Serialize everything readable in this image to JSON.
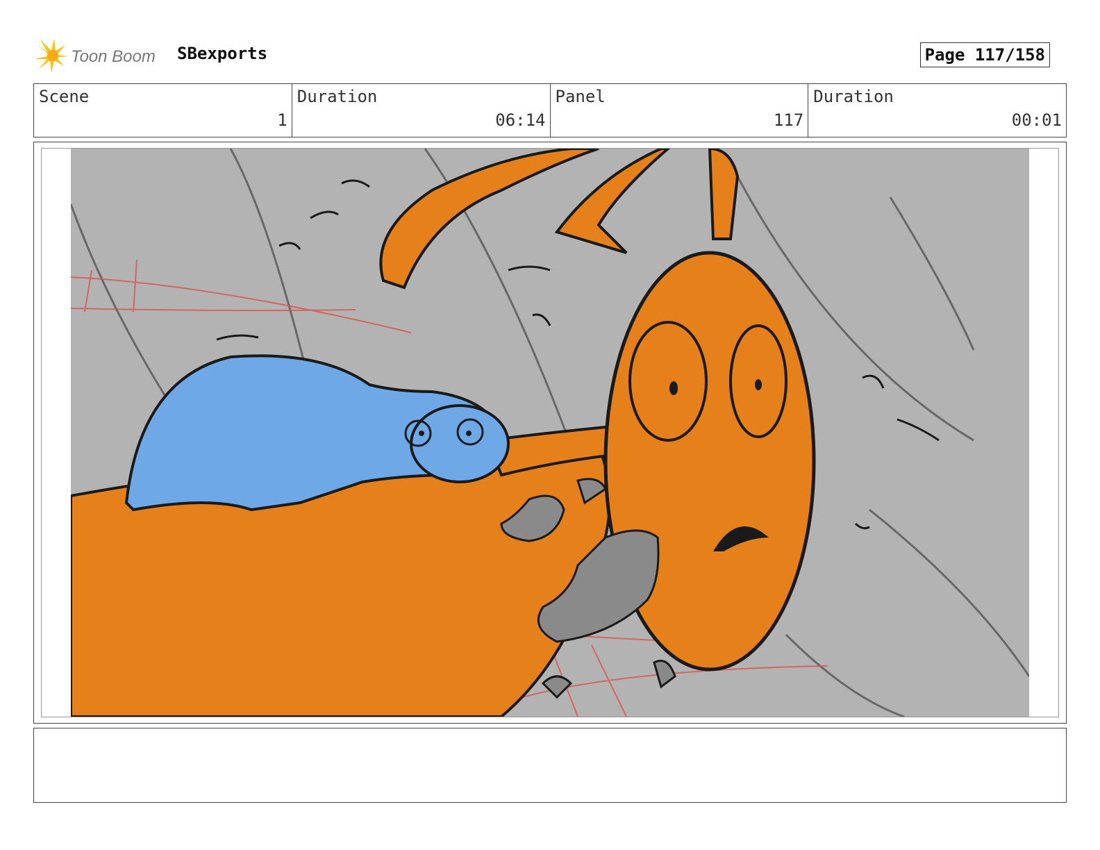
{
  "header": {
    "logo_text": "Toon Boom",
    "project": "SBexports",
    "page": "Page 117/158"
  },
  "info": {
    "scene_label": "Scene",
    "scene_value": "1",
    "scene_duration_label": "Duration",
    "scene_duration_value": "06:14",
    "panel_label": "Panel",
    "panel_value": "117",
    "panel_duration_label": "Duration",
    "panel_duration_value": "00:01"
  },
  "colors": {
    "orange": "#e5801a",
    "blue": "#6fa8e6",
    "background_gray": "#b3b3b3",
    "rubble_gray": "#8a8a8a",
    "line": "#1a1a1a",
    "red_sketch": "#d9534f"
  },
  "notes": ""
}
